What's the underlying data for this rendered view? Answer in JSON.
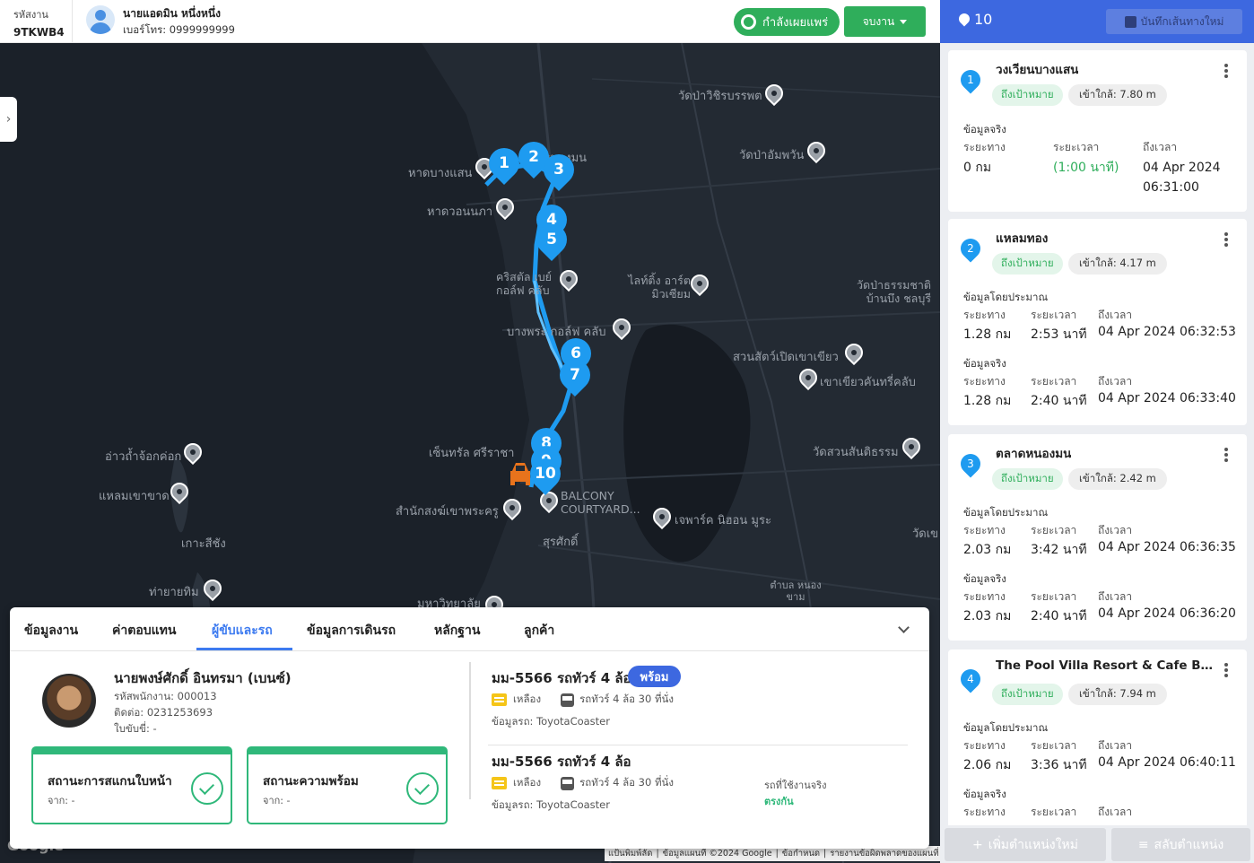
{
  "header": {
    "job_label": "รหัสงาน",
    "job_code": "9TKWB4",
    "admin_name": "นายแอดมิน หนึ่งหนึ่ง",
    "admin_phone": "เบอร์โทร: 0999999999",
    "publish_label": "กำลังเผยแพร่",
    "end_label": "จบงาน"
  },
  "map": {
    "labels": {
      "wat_pa": "วัดป่าวิชิรบรรพต",
      "hat_bangsaen": "หาดบางแสน",
      "nong_mon": "หนองมน",
      "wat_yansuk": "วัดป่าอัมพวัน",
      "hat_wonnapa": "หาดวอนนภา",
      "christiani": "คริสตัล เบย์ กอล์ฟ คลับ",
      "light_ling": "ไลท์ติ้ง อาร์ต มิวเซียม",
      "wat_thamma": "วัดป่าธรรมชาติ บ้านบึง ชลบุรี",
      "bangphra": "บางพระ กอล์ฟ คลับ",
      "zoo": "สวนสัตว์เปิดเขาเขียว",
      "khao_kheow": "เขาเขียวคันทรี่คลับ",
      "ao_thuay": "อ่าวถ้ำจ้อกค่อก",
      "central": "เซ็นทรัล ศรีราชา",
      "wat_suan": "วัดสวนสันติธรรม",
      "laem_khao": "แหลมเขาขาด",
      "balcony": "BALCONY COURTYARD...",
      "samnak": "สำนักสงฆ์เขาพระครู",
      "jphark": "เจพาร์ค นิฮอน มูระ",
      "ko_si": "เกาะสีชัง",
      "surasak": "สุรศักดิ์",
      "tha_yai": "ท่ายายทิม",
      "uni": "มหาวิทยาลัย",
      "nong_kham": "ตำบล หนองขาม",
      "wat_right": "วัดเข"
    },
    "markers": [
      "1",
      "2",
      "3",
      "4",
      "5",
      "6",
      "7",
      "8",
      "9",
      "10"
    ],
    "google": "Google",
    "attribution": [
      "แป้นพิมพ์ลัด",
      "ข้อมูลแผนที่ ©2024 Google",
      "ข้อกำหนด",
      "รายงานข้อผิดพลาดของแผนที่"
    ]
  },
  "panel": {
    "tabs": [
      "ข้อมูลงาน",
      "ค่าตอบแทน",
      "ผู้ขับและรถ",
      "ข้อมูลการเดินรถ",
      "หลักฐาน",
      "ลูกค้า"
    ],
    "active_tab": "ผู้ขับและรถ",
    "driver": {
      "name": "นายพงษ์ศักดิ์ อินทรมา (เบนซ์)",
      "emp_id": "รหัสพนักงาน: 000013",
      "contact": "ติดต่อ: 0231253693",
      "license": "ใบขับขี่: -"
    },
    "status_cards": [
      {
        "title": "สถานะการสแกนใบหน้า",
        "sub": "จาก: -"
      },
      {
        "title": "สถานะความพร้อม",
        "sub": "จาก: -"
      }
    ],
    "vehicle1": {
      "title": "มม-5566 รถทัวร์ 4 ล้อ",
      "badge": "พร้อม",
      "color": "เหลือง",
      "type": "รถทัวร์ 4 ล้อ 30 ที่นั่ง",
      "info": "ข้อมูลรถ: ToyotaCoaster"
    },
    "vehicle2": {
      "title": "มม-5566 รถทัวร์ 4 ล้อ",
      "color": "เหลือง",
      "type": "รถทัวร์ 4 ล้อ 30 ที่นั่ง",
      "info": "ข้อมูลรถ: ToyotaCoaster",
      "actual_label": "รถที่ใช้งานจริง",
      "actual_value": "ตรงกัน"
    }
  },
  "sidebar": {
    "count": "10",
    "save_label": "บันทึกเส้นทางใหม่",
    "add_label": "เพิ่มตำแหน่งใหม่",
    "reorder_label": "สลับตำแหน่ง",
    "stops": [
      {
        "num": "1",
        "name": "วงเวียนบางแสน",
        "status": "ถึงเป้าหมาย",
        "near": "เข้าใกล้: 7.80 m",
        "sec1": "ข้อมูลจริง",
        "dist_label": "ระยะทาง",
        "time_label": "ระยะเวลา",
        "arrive_label": "ถึงเวลา",
        "dist": "0 กม",
        "time": "(1:00 นาที)",
        "arrive": "04 Apr 2024 06:31:00"
      },
      {
        "num": "2",
        "name": "แหลมทอง",
        "status": "ถึงเป้าหมาย",
        "near": "เข้าใกล้: 4.17 m",
        "sec1": "ข้อมูลโดยประมาณ",
        "dist1": "1.28 กม",
        "time1": "2:53 นาที",
        "arrive1": "04 Apr 2024 06:32:53",
        "sec2": "ข้อมูลจริง",
        "dist2": "1.28 กม",
        "time2": "2:40 นาที",
        "arrive2": "04 Apr 2024 06:33:40",
        "dist_label": "ระยะทาง",
        "time_label": "ระยะเวลา",
        "arrive_label": "ถึงเวลา"
      },
      {
        "num": "3",
        "name": "ตลาดหนองมน",
        "status": "ถึงเป้าหมาย",
        "near": "เข้าใกล้: 2.42 m",
        "sec1": "ข้อมูลโดยประมาณ",
        "dist1": "2.03 กม",
        "time1": "3:42 นาที",
        "arrive1": "04 Apr 2024 06:36:35",
        "sec2": "ข้อมูลจริง",
        "dist2": "2.03 กม",
        "time2": "2:40 นาที",
        "arrive2": "04 Apr 2024 06:36:20",
        "dist_label": "ระยะทาง",
        "time_label": "ระยะเวลา",
        "arrive_label": "ถึงเวลา"
      },
      {
        "num": "4",
        "name": "The Pool Villa Resort & Cafe Bang ...",
        "status": "ถึงเป้าหมาย",
        "near": "เข้าใกล้: 7.94 m",
        "sec1": "ข้อมูลโดยประมาณ",
        "dist1": "2.06 กม",
        "time1": "3:36 นาที",
        "arrive1": "04 Apr 2024 06:40:11",
        "sec2": "ข้อมูลจริง",
        "dist_label": "ระยะทาง",
        "time_label": "ระยะเวลา",
        "arrive_label": "ถึงเวลา"
      }
    ]
  }
}
